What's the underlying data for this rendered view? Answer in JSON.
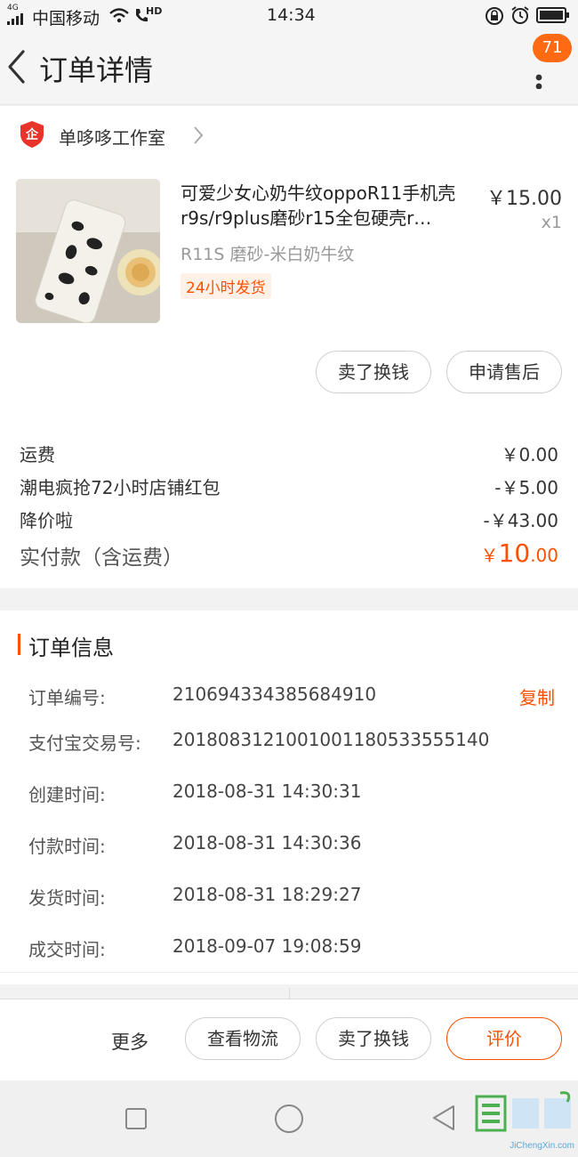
{
  "status_bar": {
    "network": "4G",
    "carrier": "中国移动",
    "hd": "HD",
    "time": "14:34"
  },
  "header": {
    "title": "订单详情",
    "badge_count": "71"
  },
  "shop": {
    "name": "单哆哆工作室"
  },
  "item": {
    "title": "可爱少女心奶牛纹oppoR11手机壳r9s/r9plus磨砂r15全包硬壳r…",
    "price": "￥15.00",
    "qty": "x1",
    "sku": "R11S 磨砂-米白奶牛纹",
    "tag": "24小时发货",
    "buttons": [
      "卖了换钱",
      "申请售后"
    ]
  },
  "fees": [
    {
      "label": "运费",
      "value": "￥0.00"
    },
    {
      "label": "潮电疯抢72小时店铺红包",
      "value": "-￥5.00"
    },
    {
      "label": "降价啦",
      "value": "-￥43.00"
    }
  ],
  "total": {
    "label": "实付款（含运费）",
    "currency": "￥",
    "integer": "10",
    "decimal": ".00"
  },
  "order_info": {
    "title": "订单信息",
    "copy_label": "复制",
    "rows": [
      {
        "label": "订单编号:",
        "value": "210694334385684910"
      },
      {
        "label": "支付宝交易号:",
        "value": "2018083121001001180533555140"
      },
      {
        "label": "创建时间:",
        "value": "2018-08-31 14:30:31"
      },
      {
        "label": "付款时间:",
        "value": "2018-08-31 14:30:36"
      },
      {
        "label": "发货时间:",
        "value": "2018-08-31 18:29:27"
      },
      {
        "label": "成交时间:",
        "value": "2018-09-07 19:08:59"
      }
    ]
  },
  "bottom_bar": {
    "more": "更多",
    "logistics": "查看物流",
    "sell": "卖了换钱",
    "review": "评价"
  },
  "watermark": {
    "text": "JiChengXin.com"
  },
  "colors": {
    "accent": "#ff5000",
    "badge": "#ff6a13",
    "shop_icon": "#e8342b"
  }
}
